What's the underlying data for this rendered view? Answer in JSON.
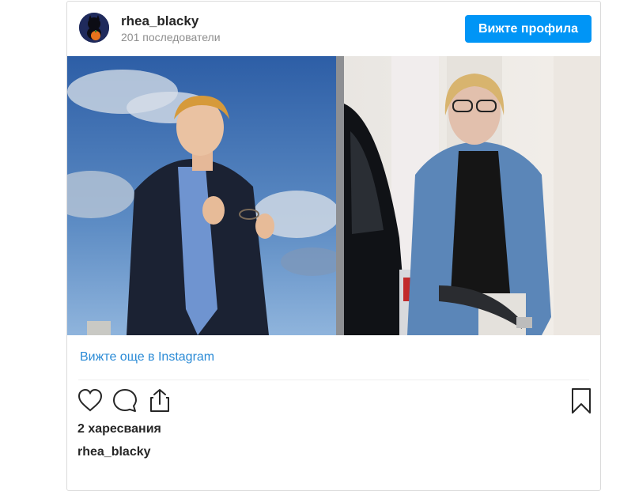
{
  "post": {
    "username": "rhea_blacky",
    "followers_text": "201 последователи",
    "view_profile_label": "Вижте профила",
    "more_link_label": "Вижте още в Instagram",
    "likes_text": "2 харесвания",
    "caption_username": "rhea_blacky"
  },
  "icons": {
    "like": "heart-icon",
    "comment": "comment-icon",
    "share": "share-icon",
    "save": "bookmark-icon"
  },
  "colors": {
    "accent": "#0095f6",
    "link": "#2b8bd6",
    "text": "#262626",
    "muted": "#8e8e8e"
  }
}
